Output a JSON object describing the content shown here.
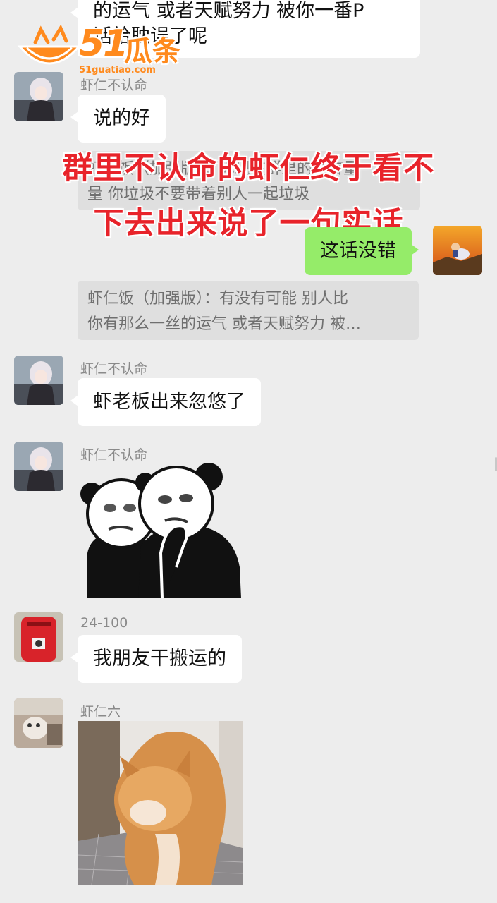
{
  "top_bubble": {
    "line1": "的运气 或者天赋努力  被你一番P",
    "line2": "话给耽误了呢"
  },
  "watermark": {
    "number": "51",
    "name": "瓜条",
    "url": "51guatiao.com"
  },
  "overlay_caption": {
    "line1": "群里不认命的虾仁终于看不",
    "line2": "下去出来说了一句实话"
  },
  "messages": [
    {
      "sender": "虾仁不认命",
      "text": "说的好"
    },
    {
      "quote_lines": [
        "虾仁饭（加强版）：你现在群里的发言量",
        "量  你垃圾不要带着别人一起垃圾"
      ]
    },
    {
      "self_text": "这话没错"
    },
    {
      "quote_lines": [
        "虾仁饭（加强版）：有没有可能  别人比",
        "你有那么一丝的运气 或者天赋努力   被…"
      ]
    },
    {
      "sender": "虾仁不认命",
      "text": "虾老板出来忽悠了"
    },
    {
      "sender": "虾仁不认命",
      "sticker": "panda-meme"
    },
    {
      "sender": "24-100",
      "text": "我朋友干搬运的"
    },
    {
      "sender": "虾仁六",
      "image": "cat-photo"
    }
  ],
  "colors": {
    "background": "#ededed",
    "self_bubble": "#95ec69",
    "overlay_red": "#e8232a",
    "watermark_orange": "#ff8a1d"
  }
}
